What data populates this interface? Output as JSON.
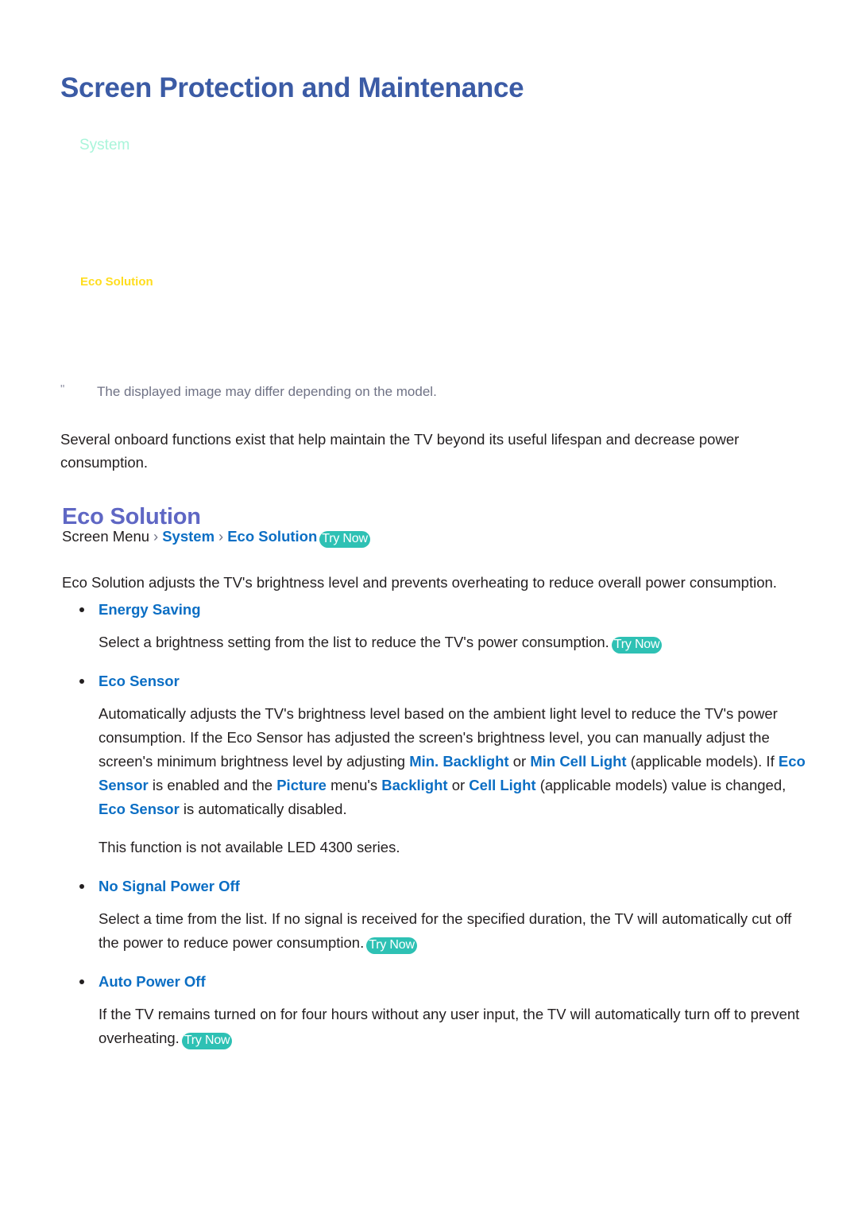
{
  "page": {
    "title": "Screen Protection and Maintenance",
    "background_color": "#ffffff"
  },
  "colors": {
    "title_blue": "#3b5ba5",
    "heading_violet": "#5f67c4",
    "link_blue": "#0b6ec4",
    "try_now_teal": "#2ec1b4",
    "menu_system_mint": "#a9f5da",
    "menu_eco_yellow": "#ffdd1e",
    "body_text": "#231f20",
    "note_gray": "#6f7285"
  },
  "menu_figure": {
    "system_label": "System",
    "eco_solution_label": "Eco Solution"
  },
  "note": {
    "mark": "\"",
    "text": "The displayed image may differ depending on the model."
  },
  "intro": "Several onboard functions exist that help maintain the TV beyond its useful lifespan and decrease power consumption.",
  "section": {
    "heading": "Eco Solution",
    "breadcrumb": {
      "root": "Screen Menu",
      "separator": "›",
      "crumb1": "System",
      "crumb2": "Eco Solution",
      "try_now": "Try Now"
    },
    "lead": "Eco Solution adjusts the TV's brightness level and prevents overheating to reduce overall power consumption."
  },
  "bullets": [
    {
      "label": "Energy Saving",
      "body_before": "Select a brightness setting from the list to reduce the TV's power consumption.",
      "try_now": "Try Now"
    },
    {
      "label": "Eco Sensor",
      "body_part1": "Automatically adjusts the TV's brightness level based on the ambient light level to reduce the TV's power consumption. If the Eco Sensor has adjusted the screen's brightness level, you can manually adjust the screen's minimum brightness level by adjusting ",
      "term1": "Min. Backlight",
      "body_part2": " or ",
      "term2": "Min Cell Light",
      "body_part3": " (applicable models). If ",
      "term3": "Eco Sensor",
      "body_part4": " is enabled and the ",
      "term4": "Picture",
      "body_part5": " menu's ",
      "term5": "Backlight",
      "body_part6": " or ",
      "term6": "Cell Light",
      "body_part7": " (applicable models) value is changed, ",
      "term7": "Eco Sensor",
      "body_part8": " is automatically disabled.",
      "extra_note": "This function is not available LED 4300 series."
    },
    {
      "label": "No Signal Power Off",
      "body_before": "Select a time from the list. If no signal is received for the specified duration, the TV will automatically cut off the power to reduce power consumption.",
      "try_now": "Try Now"
    },
    {
      "label": "Auto Power Off",
      "body_before": "If the TV remains turned on for four hours without any user input, the TV will automatically turn off to prevent overheating.",
      "try_now": "Try Now"
    }
  ]
}
